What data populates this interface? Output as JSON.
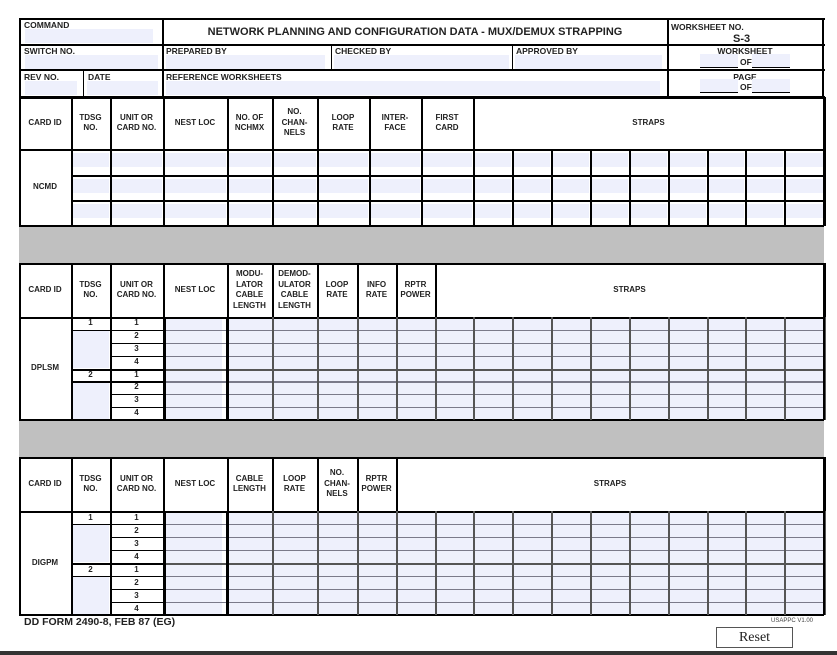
{
  "header": {
    "command_label": "COMMAND",
    "title": "NETWORK PLANNING AND CONFIGURATION DATA - MUX/DEMUX  STRAPPING",
    "worksheet_no_label": "WORKSHEET NO.",
    "worksheet_no_value": "S-3",
    "switch_no_label": "SWITCH NO.",
    "prepared_by_label": "PREPARED BY",
    "checked_by_label": "CHECKED BY",
    "approved_by_label": "APPROVED BY",
    "worksheet_label": "WORKSHEET",
    "of_label": "OF",
    "rev_no_label": "REV NO.",
    "date_label": "DATE",
    "reference_worksheets_label": "REFERENCE WORKSHEETS",
    "page_label": "PAGE"
  },
  "sections": [
    {
      "card_id": "NCMD",
      "headers": [
        "CARD ID",
        "TDSG NO.",
        "UNIT OR CARD NO.",
        "NEST LOC",
        "NO. OF NCHMX",
        "NO. CHAN- NELS",
        "LOOP RATE",
        "INTER- FACE",
        "FIRST CARD",
        "STRAPS"
      ]
    },
    {
      "card_id": "DPLSM",
      "headers": [
        "CARD ID",
        "TDSG NO.",
        "UNIT OR CARD NO.",
        "NEST LOC",
        "MODU- LATOR CABLE LENGTH",
        "DEMOD- ULATOR CABLE LENGTH",
        "LOOP RATE",
        "INFO RATE",
        "RPTR POWER",
        "STRAPS"
      ],
      "tdsg": [
        "1",
        "2"
      ],
      "units": [
        "1",
        "2",
        "3",
        "4"
      ]
    },
    {
      "card_id": "DIGPM",
      "headers": [
        "CARD ID",
        "TDSG NO.",
        "UNIT OR CARD NO.",
        "NEST LOC",
        "CABLE LENGTH",
        "LOOP RATE",
        "NO. CHAN- NELS",
        "RPTR POWER",
        "STRAPS"
      ],
      "tdsg": [
        "1",
        "2"
      ],
      "units": [
        "1",
        "2",
        "3",
        "4"
      ]
    }
  ],
  "footer": {
    "form_id": "DD FORM 2490-8, FEB 87 (EG)",
    "version": "USAPPC V1.00",
    "reset_label": "Reset"
  },
  "colors": {
    "field_fill": "#eef0fc",
    "separator_gray": "#c0c0c0"
  }
}
